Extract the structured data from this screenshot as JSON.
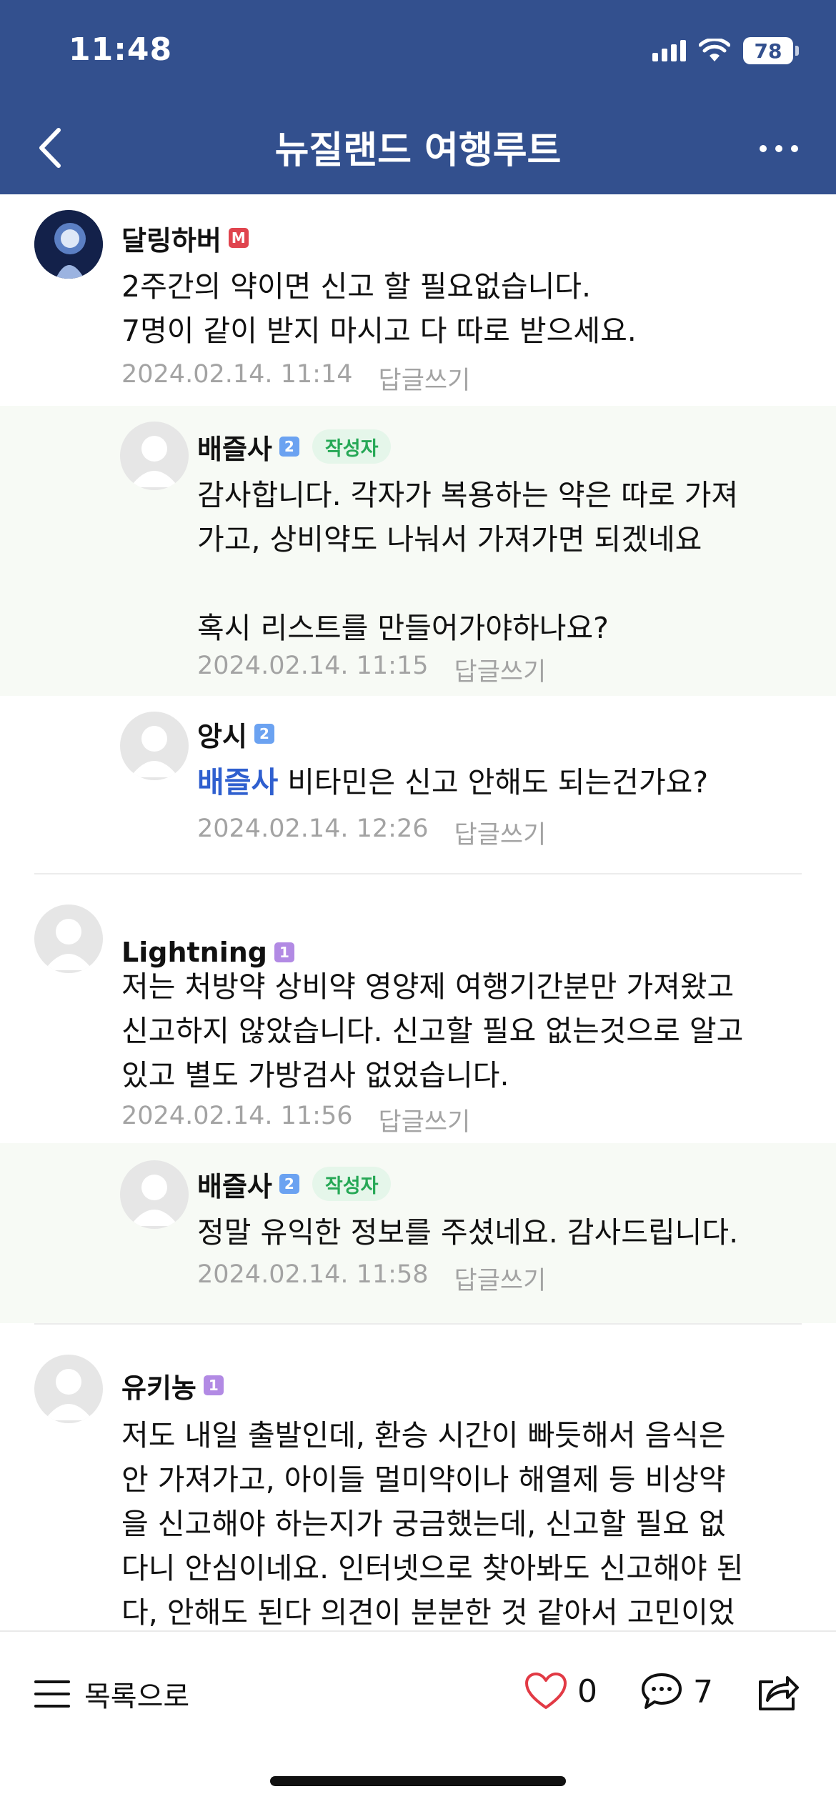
{
  "status_bar": {
    "time": "11:48",
    "battery": "78"
  },
  "header": {
    "title": "뉴질랜드 여행루트"
  },
  "comments": [
    {
      "author": "달링하버",
      "level": "M",
      "lines": [
        "2주간의 약이면 신고 할 필요없습니다.",
        "7명이 같이 받지 마시고 다 따로 받으세요."
      ],
      "date": "2024.02.14. 11:14",
      "reply_label": "답글쓰기"
    },
    {
      "author": "배즐사",
      "level": "2",
      "writer_tag": "작성자",
      "lines": [
        "감사합니다. 각자가 복용하는 약은 따로 가져",
        "가고, 상비약도 나눠서 가져가면 되겠네요",
        "",
        "혹시 리스트를 만들어가야하나요?"
      ],
      "date": "2024.02.14. 11:15",
      "reply_label": "답글쓰기"
    },
    {
      "author": "앙시",
      "level": "2",
      "mention": "배즐사",
      "text": " 비타민은 신고 안해도 되는건가요?",
      "date": "2024.02.14. 12:26",
      "reply_label": "답글쓰기"
    },
    {
      "author": "Lightning",
      "level": "1",
      "lines": [
        "저는 처방약 상비약 영양제 여행기간분만 가져왔고",
        "신고하지 않았습니다. 신고할 필요 없는것으로 알고",
        "있고 별도 가방검사 없었습니다."
      ],
      "date": "2024.02.14. 11:56",
      "reply_label": "답글쓰기"
    },
    {
      "author": "배즐사",
      "level": "2",
      "writer_tag": "작성자",
      "lines": [
        "정말 유익한 정보를 주셨네요. 감사드립니다."
      ],
      "date": "2024.02.14. 11:58",
      "reply_label": "답글쓰기"
    },
    {
      "author": "유키농",
      "level": "1",
      "lines": [
        "저도 내일 출발인데, 환승 시간이 빠듯해서 음식은",
        "안 가져가고, 아이들 멀미약이나 해열제 등 비상약",
        "을 신고해야 하는지가 궁금했는데, 신고할 필요 없",
        "다니 안심이네요. 인터넷으로 찾아봐도 신고해야 된",
        "다, 안해도 된다 의견이 분분한 것 같아서 고민이었"
      ]
    }
  ],
  "bottom_bar": {
    "list_label": "목록으로",
    "likes": "0",
    "comments": "7"
  }
}
